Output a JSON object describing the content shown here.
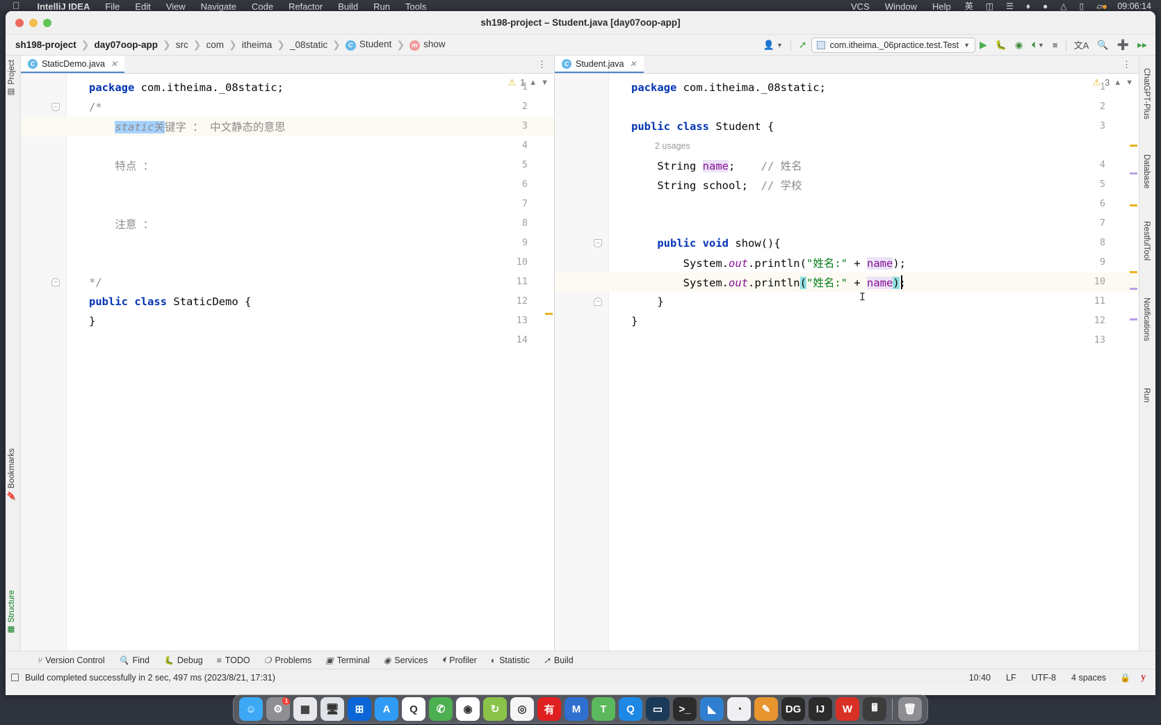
{
  "macmenu": {
    "apple": "",
    "app": "IntelliJ IDEA",
    "items": [
      "File",
      "Edit",
      "View",
      "Navigate",
      "Code",
      "Refactor",
      "Build",
      "Run",
      "Tools"
    ],
    "right_items": [
      "VCS",
      "Window",
      "Help"
    ],
    "status_icons": [
      "input-method-icon",
      "screen-mirror-icon",
      "bluetooth-icon",
      "dropbox-icon",
      "search-circle-icon",
      "wifi-icon",
      "control-center-icon",
      "battery-icon"
    ],
    "clock": "09:06:14"
  },
  "window": {
    "title": "sh198-project – Student.java [day07oop-app]"
  },
  "breadcrumb": [
    {
      "label": "sh198-project",
      "bold": true,
      "badge": ""
    },
    {
      "label": "day07oop-app",
      "bold": true,
      "badge": ""
    },
    {
      "label": "src",
      "bold": false,
      "badge": ""
    },
    {
      "label": "com",
      "bold": false,
      "badge": ""
    },
    {
      "label": "itheima",
      "bold": false,
      "badge": ""
    },
    {
      "label": "_08static",
      "bold": false,
      "badge": ""
    },
    {
      "label": "Student",
      "bold": false,
      "badge": "C"
    },
    {
      "label": "show",
      "bold": false,
      "badge": "m"
    }
  ],
  "toolbar": {
    "account_icon": "user-avatar-icon",
    "build_icon": "hammer-icon",
    "run_config": "com.itheima._06practice.test.Test",
    "run_icon": "run-play-icon",
    "debug_icon": "debug-bug-icon",
    "coverage_icon": "run-coverage-icon",
    "profiler_icon": "profiler-icon",
    "stop_icon": "stop-square-icon",
    "translate_icon": "translate-icon",
    "search_icon": "search-icon",
    "plus_icon": "plus-circle-icon",
    "updates_icon": "update-arrow-icon"
  },
  "left_strip": {
    "project": "Project",
    "bookmarks": "Bookmarks",
    "structure": "Structure"
  },
  "right_strip": {
    "items": [
      "ChatGPT-Plus",
      "Database",
      "RestfulTool",
      "Notifications",
      "Run"
    ]
  },
  "editor_left": {
    "tab": "StaticDemo.java",
    "tab_icon_letter": "C",
    "warning_count": "1",
    "lines": [
      {
        "n": "1",
        "html": "<span class='k'>package</span> <span class='pln'>com.itheima._08static;</span>"
      },
      {
        "n": "2",
        "html": "<span class='cm'>/*</span>",
        "fold": "open"
      },
      {
        "n": "3",
        "html": "<span class='cm'>    </span><span class='sel'><span class='cm-i'>static</span><span class='cm'>关</span></span><span class='cm'>键字 ： 中文静态的意思</span>",
        "highlight": true
      },
      {
        "n": "4",
        "html": ""
      },
      {
        "n": "5",
        "html": "<span class='cm'>    特点 ：</span>"
      },
      {
        "n": "6",
        "html": ""
      },
      {
        "n": "7",
        "html": ""
      },
      {
        "n": "8",
        "html": "<span class='cm'>    注意 ：</span>"
      },
      {
        "n": "9",
        "html": ""
      },
      {
        "n": "10",
        "html": ""
      },
      {
        "n": "11",
        "html": "<span class='cm'>*/</span>",
        "fold": "close"
      },
      {
        "n": "12",
        "html": "<span class='k'>public</span> <span class='k'>class</span> <span class='pln'>StaticDemo</span> <span class='pln'>{</span>"
      },
      {
        "n": "13",
        "html": "<span class='pln'>}</span>"
      },
      {
        "n": "14",
        "html": ""
      }
    ]
  },
  "editor_right": {
    "tab": "Student.java",
    "tab_icon_letter": "C",
    "warning_count": "3",
    "usages_label": "2 usages",
    "lines": [
      {
        "n": "1",
        "html": "<span class='k'>package</span> <span class='pln'>com.itheima._08static;</span>"
      },
      {
        "n": "2",
        "html": ""
      },
      {
        "n": "3",
        "html": "<span class='k'>public</span> <span class='k'>class</span> <span class='pln'>Student</span> <span class='pln'>{</span>"
      },
      {
        "n": "4",
        "html": "<span class='pln'>    String </span><span class='ident-hl'><span class='fld'>name</span></span><span class='pln'>;</span>    <span class='cm'>// 姓名</span>"
      },
      {
        "n": "5",
        "html": "<span class='pln'>    String school;</span>  <span class='cm'>// 学校</span>"
      },
      {
        "n": "6",
        "html": ""
      },
      {
        "n": "7",
        "html": ""
      },
      {
        "n": "8",
        "html": "<span class='pln'>    </span><span class='k'>public</span> <span class='k'>void</span> <span class='pln'>show(){</span>",
        "fold": "open"
      },
      {
        "n": "9",
        "html": "<span class='pln'>        System.</span><span class='stat'>out</span><span class='pln'>.println(</span><span class='str'>\"姓名:\"</span><span class='pln'> + </span><span class='ident-hl'><span class='fld'>name</span></span><span class='pln'>);</span>"
      },
      {
        "n": "10",
        "html": "<span class='pln'>        System.</span><span class='stat'>out</span><span class='pln'>.println</span><span class='brace-hl'>(</span><span class='str'>\"姓名:\"</span><span class='pln'> + </span><span class='ident-hl'><span class='fld'>name</span></span><span class='brace-hl'>)</span><span class='pln'>;</span>",
        "highlight": true,
        "caret": true
      },
      {
        "n": "11",
        "html": "<span class='pln'>    }</span>",
        "fold": "close"
      },
      {
        "n": "12",
        "html": "<span class='pln'>}</span>"
      },
      {
        "n": "13",
        "html": ""
      }
    ]
  },
  "bottom_tools": [
    {
      "label": "Version Control",
      "icon": "branch-icon"
    },
    {
      "label": "Find",
      "icon": "search-icon"
    },
    {
      "label": "Debug",
      "icon": "debug-bug-icon"
    },
    {
      "label": "TODO",
      "icon": "list-icon"
    },
    {
      "label": "Problems",
      "icon": "error-circle-icon"
    },
    {
      "label": "Terminal",
      "icon": "terminal-icon"
    },
    {
      "label": "Services",
      "icon": "services-play-icon"
    },
    {
      "label": "Profiler",
      "icon": "profiler-icon"
    },
    {
      "label": "Statistic",
      "icon": "statistic-pie-icon"
    },
    {
      "label": "Build",
      "icon": "hammer-icon"
    }
  ],
  "statusbar": {
    "message": "Build completed successfully in 2 sec, 497 ms (2023/8/21, 17:31)",
    "caret_position": "10:40",
    "line_separator": "LF",
    "encoding": "UTF-8",
    "indent": "4 spaces",
    "lock_icon": "lock-icon",
    "plugin_icon": "youdao-icon"
  },
  "dock": {
    "apps": [
      {
        "name": "finder",
        "color": "#3da8f5",
        "glyph": "☺",
        "badge": ""
      },
      {
        "name": "system-settings",
        "color": "#8e8e93",
        "glyph": "⚙",
        "badge": "1"
      },
      {
        "name": "launchpad",
        "color": "#e8e8ec",
        "glyph": "▦",
        "badge": ""
      },
      {
        "name": "remote-desktop",
        "color": "#dfe2e6",
        "glyph": "🖥",
        "badge": ""
      },
      {
        "name": "parallels",
        "color": "#0a66d6",
        "glyph": "⊞",
        "badge": ""
      },
      {
        "name": "app-store",
        "color": "#2f9bf5",
        "glyph": "A",
        "badge": ""
      },
      {
        "name": "qq",
        "color": "#ffffff",
        "glyph": "Q",
        "badge": ""
      },
      {
        "name": "wechat",
        "color": "#4caf50",
        "glyph": "✆",
        "badge": ""
      },
      {
        "name": "tencent-meeting",
        "color": "#ffffff",
        "glyph": "◉",
        "badge": ""
      },
      {
        "name": "thunder-sync",
        "color": "#8bc34a",
        "glyph": "↻",
        "badge": ""
      },
      {
        "name": "chrome",
        "color": "#f5f5f5",
        "glyph": "◎",
        "badge": ""
      },
      {
        "name": "youdao",
        "color": "#e02020",
        "glyph": "有",
        "badge": ""
      },
      {
        "name": "mindmaster",
        "color": "#2f6fd0",
        "glyph": "М",
        "badge": ""
      },
      {
        "name": "typora",
        "color": "#5cb85c",
        "glyph": "T",
        "badge": ""
      },
      {
        "name": "qq-browser",
        "color": "#1e88e5",
        "glyph": "Q",
        "badge": ""
      },
      {
        "name": "vmware",
        "color": "#1b3a57",
        "glyph": "▭",
        "badge": ""
      },
      {
        "name": "iterm",
        "color": "#2b2b2b",
        "glyph": ">_",
        "badge": ""
      },
      {
        "name": "vscode",
        "color": "#2f7fd1",
        "glyph": "◣",
        "badge": ""
      },
      {
        "name": "safari",
        "color": "#f0f0f2",
        "glyph": "◔",
        "badge": ""
      },
      {
        "name": "sublime",
        "color": "#e8952f",
        "glyph": "✎",
        "badge": ""
      },
      {
        "name": "datagrip",
        "color": "#2b2b2b",
        "glyph": "DG",
        "badge": ""
      },
      {
        "name": "intellij-idea",
        "color": "#2b2b2b",
        "glyph": "IJ",
        "badge": ""
      },
      {
        "name": "wps-writer",
        "color": "#d93025",
        "glyph": "W",
        "badge": ""
      },
      {
        "name": "calculator",
        "color": "#3c3c3c",
        "glyph": "🖩",
        "badge": ""
      },
      {
        "name": "trash",
        "color": "#8e8e93",
        "glyph": "🗑",
        "badge": ""
      }
    ]
  }
}
